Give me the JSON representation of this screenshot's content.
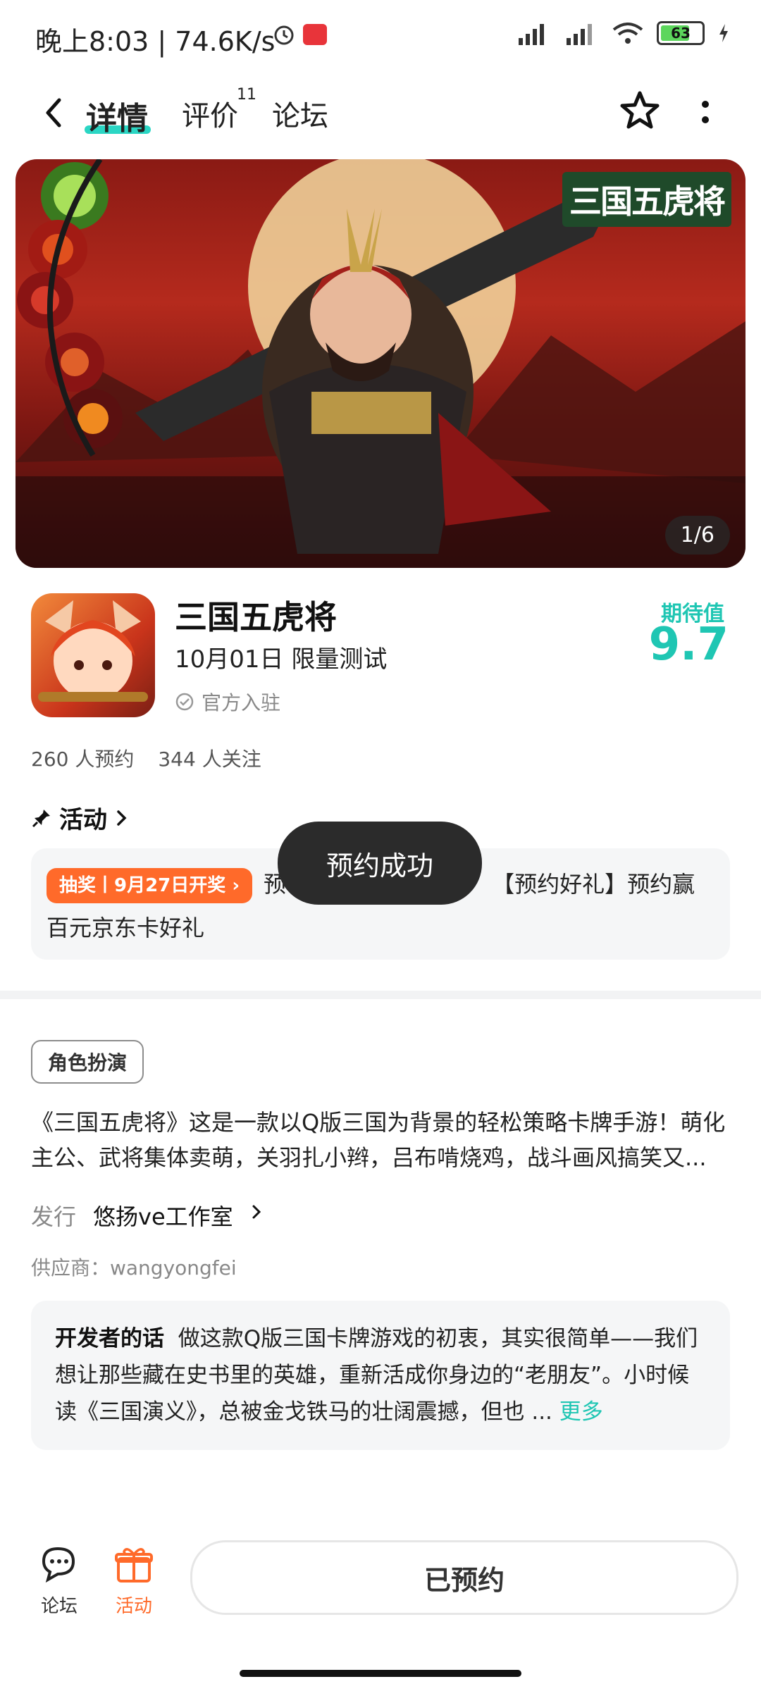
{
  "status": {
    "time": "晚上8:03 | 74.6K/s",
    "battery": "63"
  },
  "nav": {
    "tabs": [
      {
        "label": "详情"
      },
      {
        "label": "评价",
        "badge": "11"
      },
      {
        "label": "论坛"
      }
    ]
  },
  "hero": {
    "overlay_title": "三国五虎将",
    "counter": "1/6"
  },
  "app": {
    "name": "三国五虎将",
    "release": "10月01日 限量测试",
    "official": "官方入驻",
    "expect_label": "期待值",
    "expect_value": "9.7",
    "reservations": "260 人预约",
    "followers": "344 人关注"
  },
  "activity": {
    "header": "活动",
    "pill": "抽奖丨9月27日开奖 ›",
    "text_before_toast": "预",
    "text_after_toast": "【预约好礼】预约赢百元京东卡好礼"
  },
  "toast": "预约成功",
  "details": {
    "tag": "角色扮演",
    "description": "《三国五虎将》这是一款以Q版三国为背景的轻松策略卡牌手游！萌化主公、武将集体卖萌，关羽扎小辫，吕布啃烧鸡，战斗画风搞笑又...",
    "publisher_label": "发行",
    "publisher": "悠扬ve工作室",
    "supplier": "供应商：wangyongfei"
  },
  "developer": {
    "label": "开发者的话",
    "text": "做这款Q版三国卡牌游戏的初衷，其实很简单——我们想让那些藏在史书里的英雄，重新活成你身边的“老朋友”。小时候读《三国演义》，总被金戈铁马的壮阔震撼，但也 ...",
    "more": "更多"
  },
  "bottom": {
    "forum": "论坛",
    "activity": "活动",
    "reserve_button": "已预约"
  },
  "colors": {
    "accent": "#1fc6b3",
    "orange": "#ff6a2a",
    "toast_bg": "#2b2b2b"
  }
}
